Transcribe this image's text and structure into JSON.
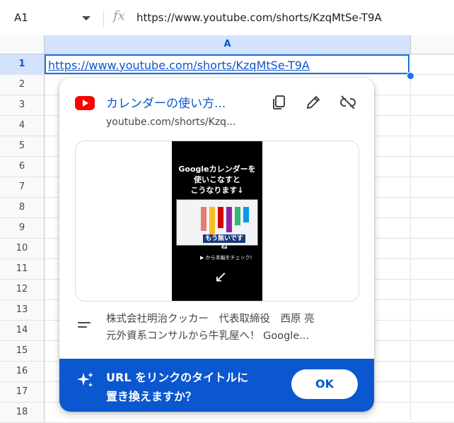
{
  "formula_bar": {
    "namebox": "A1",
    "fx_label": "fx",
    "value": "https://www.youtube.com/shorts/KzqMtSe-T9A"
  },
  "grid": {
    "column_headers": [
      "A"
    ],
    "row_numbers": [
      "1",
      "2",
      "3",
      "4",
      "5",
      "6",
      "7",
      "8",
      "9",
      "10",
      "11",
      "12",
      "13",
      "14",
      "15",
      "16",
      "17",
      "18"
    ],
    "cell_a1": "https://www.youtube.com/shorts/KzqMtSe-T9A"
  },
  "chip": {
    "title": "カレンダーの使い方...",
    "subtitle": "youtube.com/shorts/Kzq...",
    "actions": [
      "copy-icon",
      "edit-icon",
      "unlink-icon"
    ],
    "thumbnail": {
      "caption_line1": "Googleカレンダーを",
      "caption_line2": "使いこなすと",
      "caption_line3": "こうなります↓",
      "banner": "もう無いですね",
      "footer": "▶ から本編をチェック!"
    },
    "description_line1": "株式会社明治クッカー　代表取締役　西原 亮",
    "description_line2": "元外資系コンサルから牛乳屋へ！ Google..."
  },
  "suggestion": {
    "line1": "URL をリンクのタイトルに",
    "line2": "置き換えますか？",
    "ok_label": "OK"
  },
  "colors": {
    "accent": "#0b57d0",
    "youtube_red": "#ff0000",
    "selection": "#d3e3fd"
  }
}
